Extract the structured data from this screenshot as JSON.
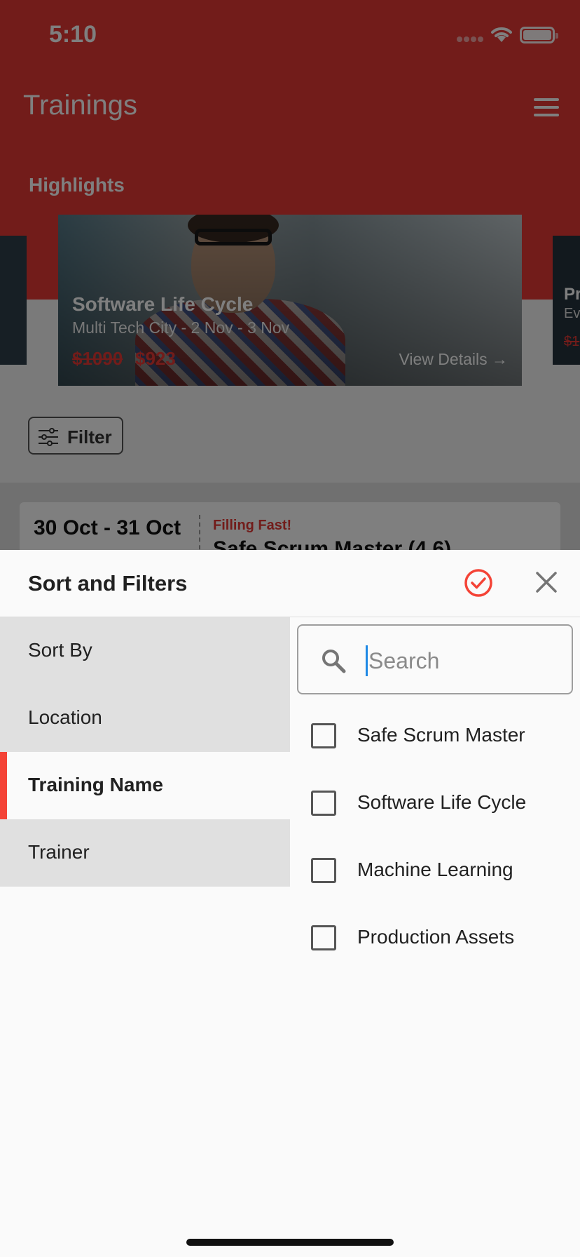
{
  "status_bar": {
    "time": "5:10"
  },
  "app": {
    "title": "Trainings",
    "highlights_label": "Highlights",
    "highlight_cards": [
      {
        "title": "Software Life Cycle",
        "subtitle": "Multi Tech City - 2 Nov - 3 Nov",
        "old_price": "$1090",
        "price": "$923",
        "link": "View Details →"
      }
    ],
    "side_card_right": {
      "title": "Pr",
      "subtitle": "Ev",
      "price": "$1"
    },
    "filter_button": "Filter",
    "list_preview": {
      "date": "30 Oct - 31 Oct",
      "badge": "Filling Fast!",
      "name": "Safe Scrum Master (4.6)"
    }
  },
  "sheet": {
    "title": "Sort and Filters",
    "accent_color": "#f44336",
    "nav": [
      {
        "label": "Sort By",
        "active": false
      },
      {
        "label": "Location",
        "active": false
      },
      {
        "label": "Training Name",
        "active": true
      },
      {
        "label": "Trainer",
        "active": false
      }
    ],
    "search": {
      "placeholder": "Search",
      "value": ""
    },
    "options": [
      {
        "label": "Safe Scrum Master",
        "checked": false
      },
      {
        "label": "Software Life Cycle",
        "checked": false
      },
      {
        "label": "Machine Learning",
        "checked": false
      },
      {
        "label": "Production Assets",
        "checked": false
      }
    ]
  }
}
